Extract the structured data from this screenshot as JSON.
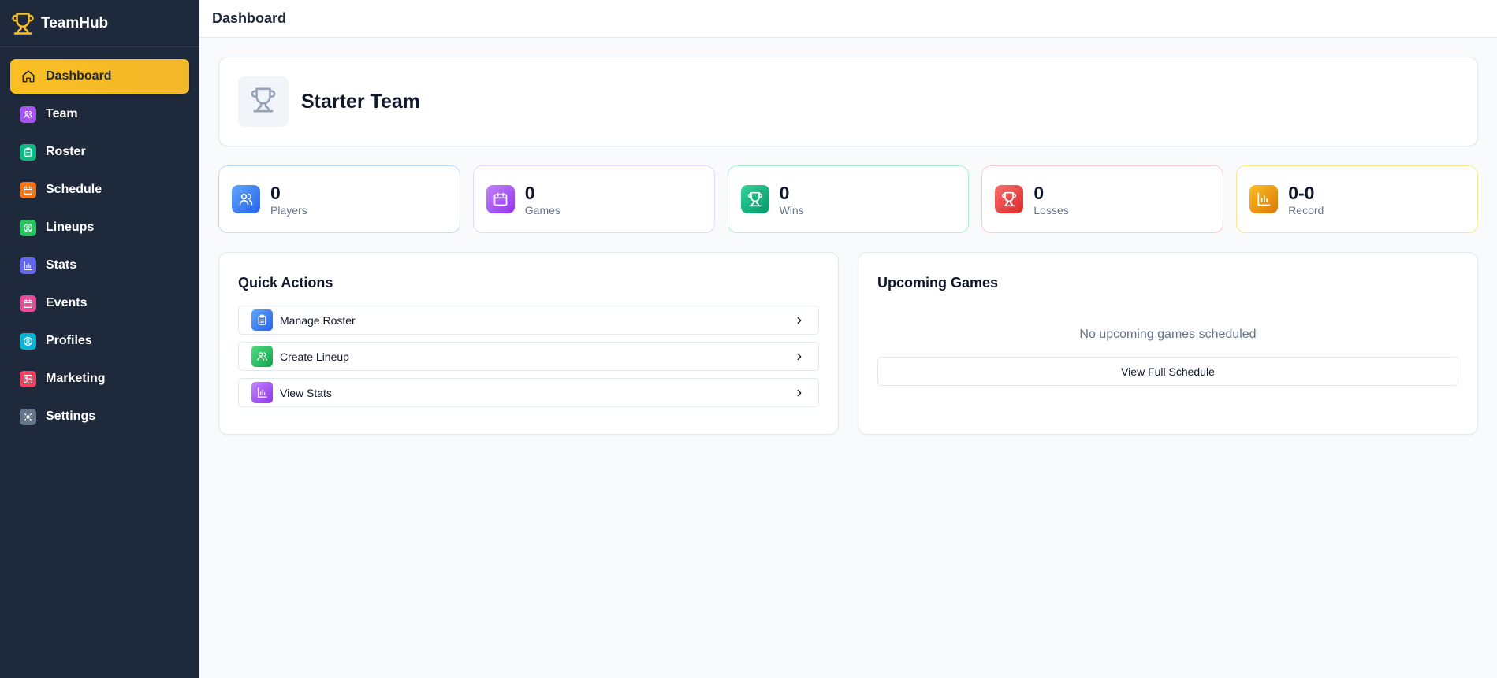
{
  "app": {
    "name": "TeamHub"
  },
  "colors": {
    "sidebar_bg": "#1e293b",
    "accent": "#fbbf24",
    "players": "#3b82f6",
    "games": "#a855f7",
    "wins": "#10b981",
    "losses": "#ef4444",
    "record": "#f59e0b"
  },
  "sidebar": {
    "items": [
      {
        "label": "Dashboard",
        "icon": "home-icon",
        "active": true
      },
      {
        "label": "Team",
        "icon": "users-icon",
        "color": "#a855f7"
      },
      {
        "label": "Roster",
        "icon": "clipboard-icon",
        "color": "#10b981"
      },
      {
        "label": "Schedule",
        "icon": "calendar-icon",
        "color": "#f97316"
      },
      {
        "label": "Lineups",
        "icon": "user-circle-icon",
        "color": "#22c55e"
      },
      {
        "label": "Stats",
        "icon": "bar-chart-icon",
        "color": "#6366f1"
      },
      {
        "label": "Events",
        "icon": "calendar-icon",
        "color": "#ec4899"
      },
      {
        "label": "Profiles",
        "icon": "user-circle-icon",
        "color": "#06b6d4"
      },
      {
        "label": "Marketing",
        "icon": "image-icon",
        "color": "#f43f5e"
      },
      {
        "label": "Settings",
        "icon": "gear-icon",
        "color": "#64748b"
      }
    ]
  },
  "header": {
    "title": "Dashboard"
  },
  "team": {
    "name": "Starter Team"
  },
  "stats": [
    {
      "value": "0",
      "label": "Players",
      "icon": "users-icon"
    },
    {
      "value": "0",
      "label": "Games",
      "icon": "calendar-icon"
    },
    {
      "value": "0",
      "label": "Wins",
      "icon": "trophy-icon"
    },
    {
      "value": "0",
      "label": "Losses",
      "icon": "trophy-icon"
    },
    {
      "value": "0-0",
      "label": "Record",
      "icon": "bar-chart-icon"
    }
  ],
  "quick_actions": {
    "title": "Quick Actions",
    "items": [
      {
        "label": "Manage Roster",
        "icon": "clipboard-icon"
      },
      {
        "label": "Create Lineup",
        "icon": "users-icon"
      },
      {
        "label": "View Stats",
        "icon": "bar-chart-icon"
      }
    ]
  },
  "upcoming": {
    "title": "Upcoming Games",
    "empty_text": "No upcoming games scheduled",
    "button_label": "View Full Schedule"
  }
}
